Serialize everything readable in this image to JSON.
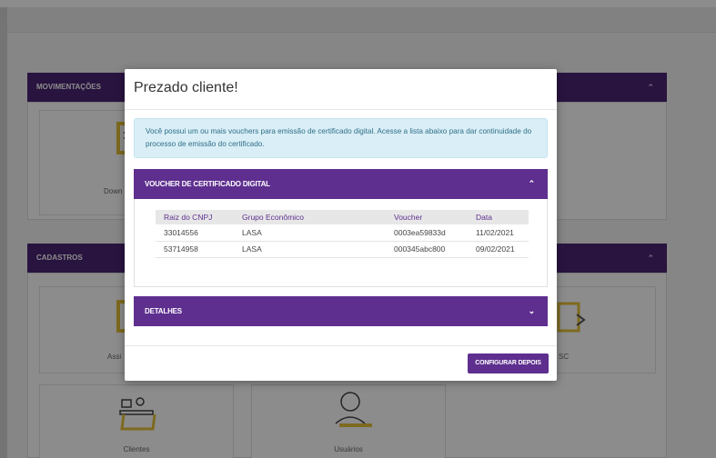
{
  "background": {
    "movimentacoes_title": "MOVIMENTAÇÕES",
    "cadastros_title": "CADASTROS",
    "partial_download": "Down",
    "partial_assi": "Assi",
    "partial_sc": "SC",
    "card_clientes": "Clientes",
    "card_usuarios": "Usuários"
  },
  "modal": {
    "title": "Prezado cliente!",
    "info_text": "Você possui um ou mais vouchers para emissão de certificado digital. Acesse a lista abaixo para dar continuidade do processo de emissão do certificado.",
    "voucher_section": {
      "title": "VOUCHER DE CERTIFICADO DIGITAL",
      "columns": [
        "Raiz do CNPJ",
        "Grupo Econômico",
        "Voucher",
        "Data"
      ],
      "rows": [
        [
          "33014556",
          "LASA",
          "0003ea59833d",
          "11/02/2021"
        ],
        [
          "53714958",
          "LASA",
          "000345abc800",
          "09/02/2021"
        ]
      ]
    },
    "details_section": {
      "title": "DETALHES"
    },
    "configure_button": "CONFIGURAR DEPOIS"
  },
  "colors": {
    "accent": "#5e2f8f",
    "section_bar": "#4b2676",
    "info_bg": "#d9eef6",
    "info_text": "#2f6f88",
    "icon_yellow": "#e6c13a"
  },
  "icons": [
    "chevron-up-icon",
    "chevron-down-icon",
    "document-icon",
    "code-icon",
    "desk-icon",
    "user-icon"
  ]
}
